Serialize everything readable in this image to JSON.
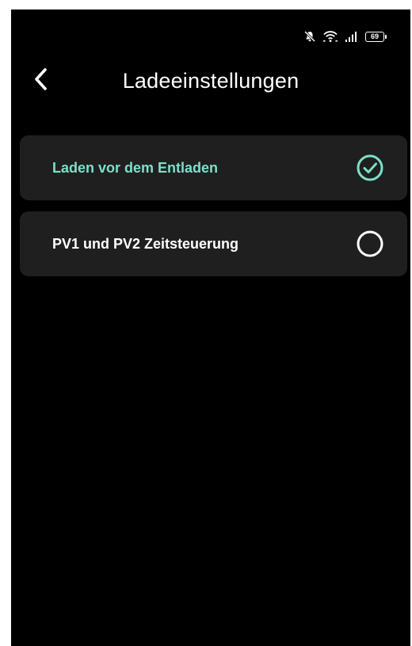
{
  "status_bar": {
    "icons": [
      "mute-bell-icon",
      "wifi-icon",
      "signal-icon",
      "battery-icon"
    ],
    "battery_level": "69"
  },
  "header": {
    "back_icon": "chevron-left-icon",
    "title": "Ladeeinstellungen"
  },
  "options": [
    {
      "label": "Laden vor dem Entladen",
      "selected": true
    },
    {
      "label": "PV1 und PV2 Zeitsteuerung",
      "selected": false
    }
  ],
  "colors": {
    "background": "#000000",
    "card": "#1f1f1f",
    "accent": "#7ce0c8",
    "text": "#ffffff"
  }
}
